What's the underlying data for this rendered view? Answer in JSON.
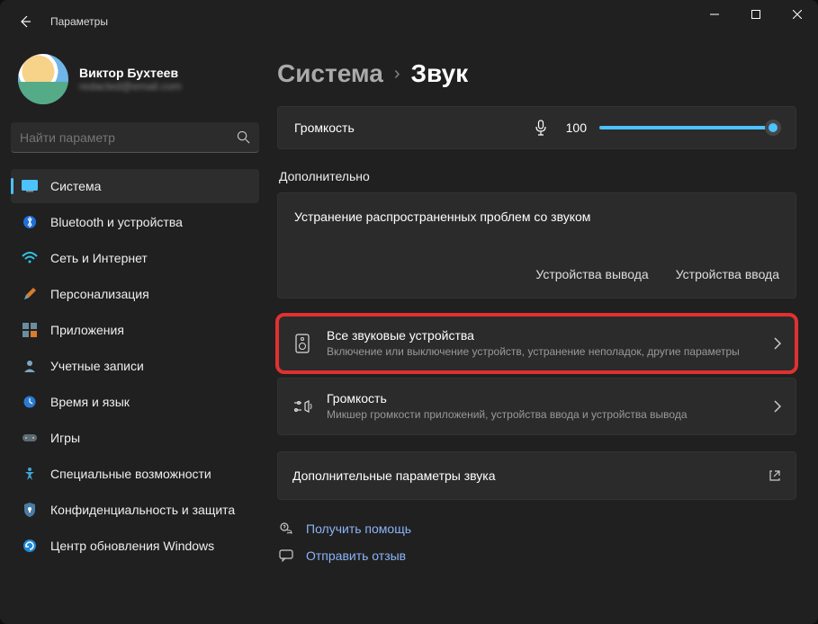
{
  "window": {
    "title": "Параметры"
  },
  "profile": {
    "name": "Виктор Бухтеев",
    "email": "redacted@email.com"
  },
  "search": {
    "placeholder": "Найти параметр"
  },
  "nav": {
    "items": [
      {
        "label": "Система"
      },
      {
        "label": "Bluetooth и устройства"
      },
      {
        "label": "Сеть и Интернет"
      },
      {
        "label": "Персонализация"
      },
      {
        "label": "Приложения"
      },
      {
        "label": "Учетные записи"
      },
      {
        "label": "Время и язык"
      },
      {
        "label": "Игры"
      },
      {
        "label": "Специальные возможности"
      },
      {
        "label": "Конфиденциальность и защита"
      },
      {
        "label": "Центр обновления Windows"
      }
    ]
  },
  "breadcrumb": {
    "parent": "Система",
    "sep": "›",
    "current": "Звук"
  },
  "volume": {
    "label": "Громкость",
    "value": "100"
  },
  "section_additional": "Дополнительно",
  "troubleshoot": {
    "title": "Устранение распространенных проблем со звуком",
    "out": "Устройства вывода",
    "in": "Устройства ввода"
  },
  "all_devices": {
    "title": "Все звуковые устройства",
    "desc": "Включение или выключение устройств, устранение неполадок, другие параметры"
  },
  "mixer": {
    "title": "Громкость",
    "desc": "Микшер громкости приложений, устройства ввода и устройства вывода"
  },
  "more_sound": "Дополнительные параметры звука",
  "footer": {
    "help": "Получить помощь",
    "feedback": "Отправить отзыв"
  }
}
